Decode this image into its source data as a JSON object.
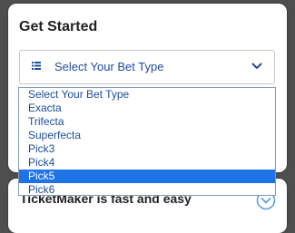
{
  "card": {
    "title": "Get Started"
  },
  "select": {
    "icon": "list-icon",
    "value": "Select Your Bet Type",
    "chevron_icon": "chevron-down-icon"
  },
  "dropdown": {
    "options": [
      "Select Your Bet Type",
      "Exacta",
      "Trifecta",
      "Superfecta",
      "Pick3",
      "Pick4",
      "Pick5",
      "Pick6"
    ],
    "highlighted_option": "Pick5"
  },
  "bottom_card": {
    "title": "TicketMaker is fast and easy",
    "expand_icon": "chevron-down-circle-icon"
  },
  "colors": {
    "accent": "#1d4e9b",
    "highlight": "#1e73e8",
    "expand_icon": "#5aa3e6",
    "background": "#4e4e4e"
  }
}
